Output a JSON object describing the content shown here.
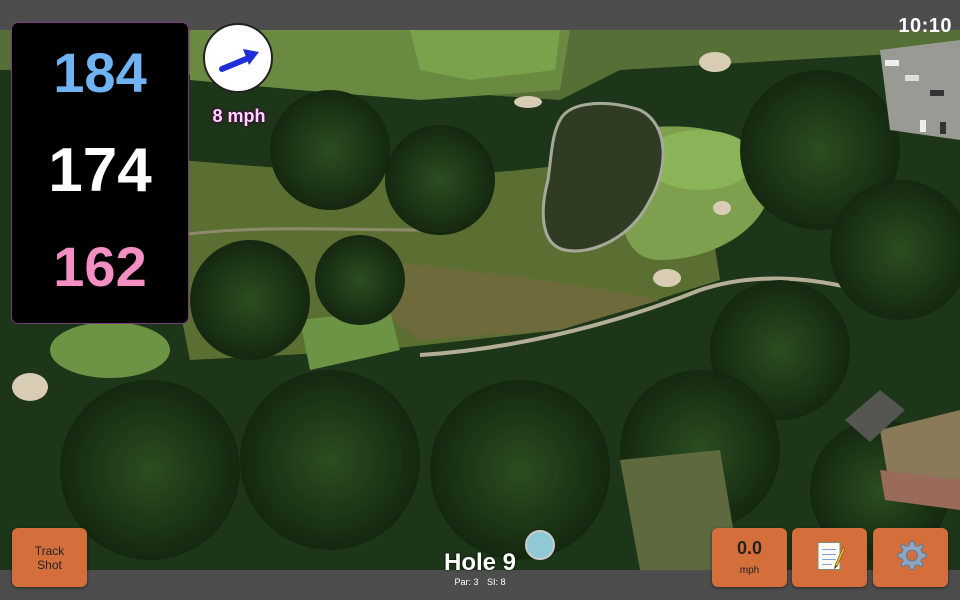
{
  "status": {
    "time": "10:10"
  },
  "distances": {
    "back": "184",
    "middle": "174",
    "front": "162",
    "colors": {
      "back": "#6fb3f2",
      "middle": "#ffffff",
      "front": "#f48fc4"
    }
  },
  "wind": {
    "speed_label": "8 mph",
    "icon": "wind-direction-arrow-icon"
  },
  "buttons": {
    "track_shot_line1": "Track",
    "track_shot_line2": "Shot",
    "swing_speed_value": "0.0",
    "swing_speed_unit": "mph",
    "notes_icon": "notepad-icon",
    "settings_icon": "gear-icon"
  },
  "hole": {
    "title": "Hole 9",
    "par_label": "Par: 3",
    "si_label": "SI: 8"
  },
  "theme": {
    "button_color": "#d46f3c",
    "bar_color": "#4d4d4d"
  }
}
